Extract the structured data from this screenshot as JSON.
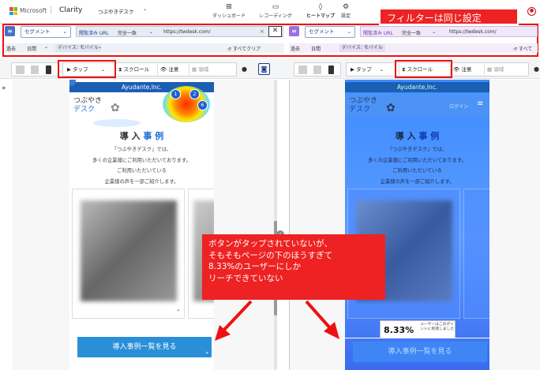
{
  "header": {
    "brand": "Microsoft",
    "app": "Clarity",
    "project": "つぶやきデスク",
    "nav": [
      {
        "label": "ダッシュボード",
        "icon": "grid-icon"
      },
      {
        "label": "レコーディング",
        "icon": "video-icon"
      },
      {
        "label": "ヒートマップ",
        "icon": "flame-icon"
      },
      {
        "label": "設定",
        "icon": "gear-icon"
      }
    ]
  },
  "annotation_title": "フィルターは同じ設定",
  "left": {
    "segment": "セグメント",
    "url_label": "閲覧済み URL",
    "match": "完全一致",
    "url": "https://twdesk.com/",
    "period": "過去",
    "period_value": "日間",
    "device": "デバイス: モバイル",
    "clear": "すべてクリア",
    "tool1": "タップ",
    "tool2": "スクロール",
    "tool3": "注意",
    "tool4": "領域"
  },
  "right": {
    "segment": "セグメント",
    "url_label": "閲覧済み URL",
    "match": "完全一致",
    "url": "https://twdesk.com/",
    "period": "過去",
    "period_value": "日間",
    "device": "デバイス: モバイル",
    "clear": "すべて",
    "tool1": "タップ",
    "tool2": "スクロール",
    "tool3": "注意",
    "tool4": "領域"
  },
  "page": {
    "banner": "Ayudante,Inc.",
    "logo1": "つぶやき",
    "logo2": "デスク",
    "login": "ログイン",
    "title_a": "導 入 ",
    "title_b": "事 例",
    "lines": [
      "「つぶやきデスク」では、",
      "多くの企業様にご利用いただいております。",
      "ご利用いただいている",
      "企業様の声を一部ご紹介します。"
    ],
    "cta": "導入事例一覧を見る",
    "heat_counts": [
      "1",
      "2",
      "6"
    ]
  },
  "scroll_badge": {
    "percent": "8.33%",
    "text": "ユーザーはこのポイントに到達しました"
  },
  "callout": [
    "ボタンがタップされていないが、",
    "そもそもページの下のほうすぎて",
    "8.33%のユーザーにしか",
    "リーチできていない"
  ]
}
